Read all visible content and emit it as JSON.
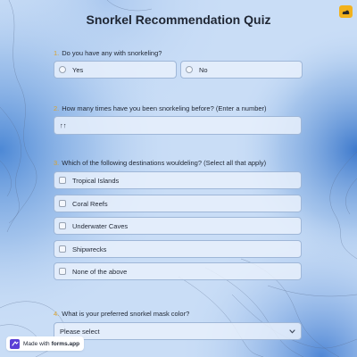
{
  "quiz": {
    "title": "Snorkel Recommendation Quiz"
  },
  "questions": [
    {
      "number": "1.",
      "text": "Do you have any with snorkeling?",
      "options": [
        "Yes",
        "No"
      ]
    },
    {
      "number": "2.",
      "text": "How many times have you been snorkeling before? (Enter a number)",
      "value": "↑↑"
    },
    {
      "number": "3.",
      "text": "Which of the following destinations wouldeling? (Select all that apply)",
      "options": [
        "Tropical Islands",
        "Coral Reefs",
        "Underwater Caves",
        "Shipwrecks",
        "None of the above"
      ]
    },
    {
      "number": "4.",
      "text": "What is your preferred snorkel mask color?",
      "placeholder": "Please select"
    }
  ],
  "badge": {
    "prefix": "Made with",
    "brand": "forms.app"
  },
  "icons": {
    "corner": "theme-icon",
    "select": "chevron-down-icon",
    "logo": "forms-app-logo-icon"
  },
  "colors": {
    "background": "#c7dcf6",
    "accent": "#d9a22e",
    "corner_button": "#f2b21d",
    "logo": "#5b3fd6"
  }
}
